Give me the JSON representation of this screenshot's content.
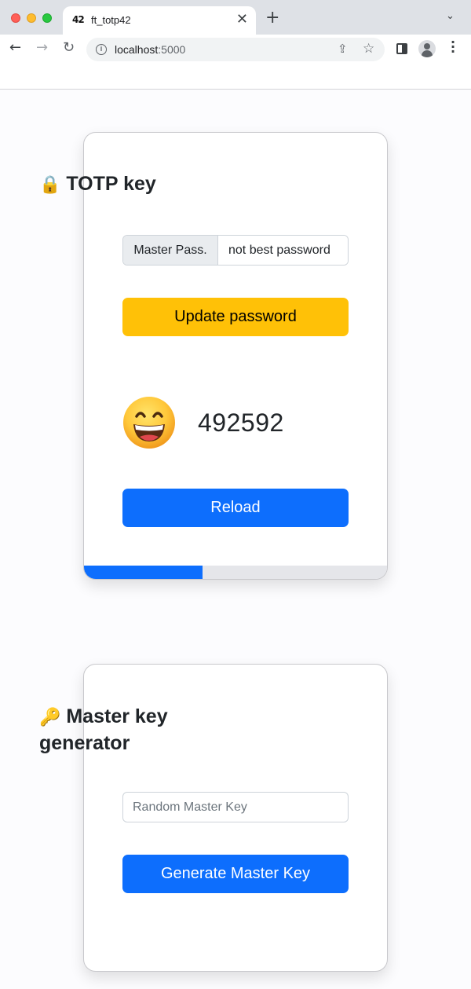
{
  "browser": {
    "tab_title": "ft_totp42",
    "tab_favicon": "42",
    "tab_close": "✕",
    "new_tab": "+",
    "tab_dropdown": "⌄",
    "url_host": "localhost",
    "url_port": ":5000",
    "icons": {
      "back": "←",
      "forward": "→",
      "reload": "↻",
      "share": "⇪",
      "star": "☆",
      "info": "i",
      "menu": "⋮"
    }
  },
  "totp": {
    "title_emoji": "🔒",
    "title": "TOTP key",
    "master_label": "Master Pass.",
    "master_value": "not best password",
    "update_label": "Update password",
    "emoji_name": "grinning-face-with-smiling-eyes",
    "code": "492592",
    "reload_label": "Reload",
    "progress_fraction": 0.39
  },
  "master": {
    "title_emoji": "🔑",
    "title": "Master key generator",
    "input_placeholder": "Random Master Key",
    "input_value": "",
    "generate_label": "Generate Master Key"
  },
  "colors": {
    "primary": "#0d6efd",
    "warning": "#ffc107",
    "progress_track": "#e5e6ea"
  }
}
